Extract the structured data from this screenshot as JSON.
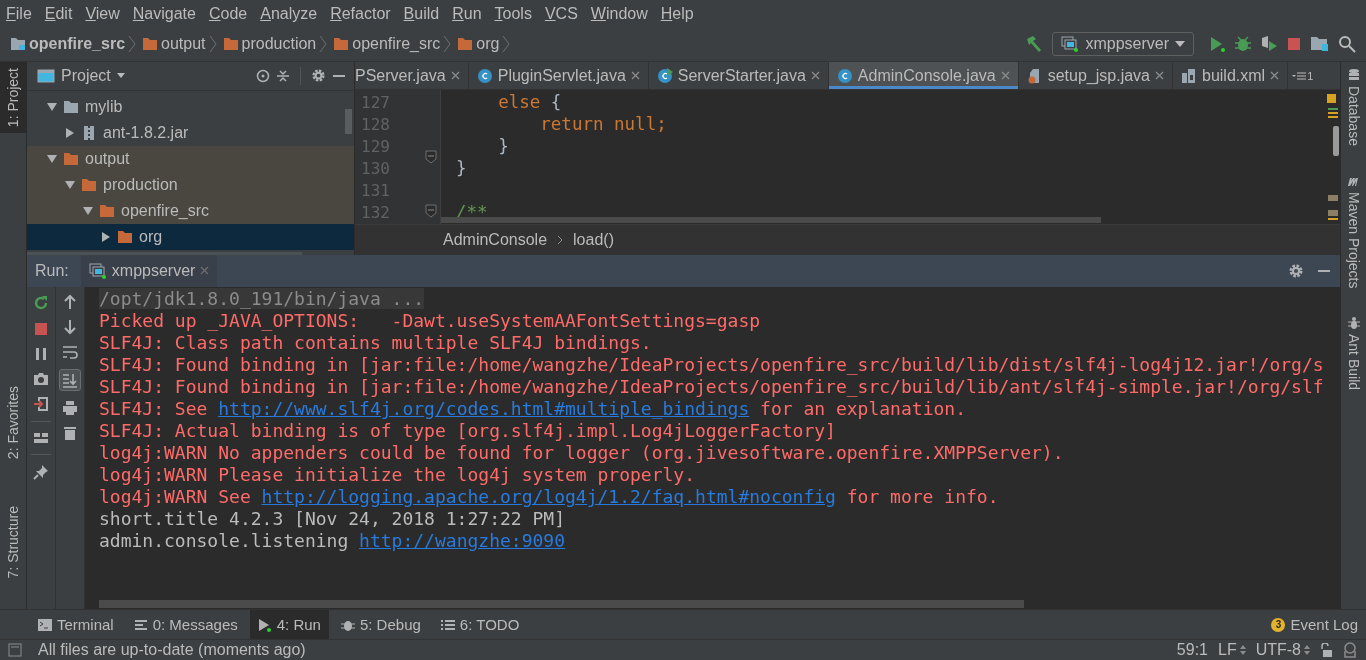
{
  "menu": [
    "File",
    "Edit",
    "View",
    "Navigate",
    "Code",
    "Analyze",
    "Refactor",
    "Build",
    "Run",
    "Tools",
    "VCS",
    "Window",
    "Help"
  ],
  "nav_bar": {
    "breadcrumbs": [
      {
        "label": "openfire_src",
        "kind": "module"
      },
      {
        "label": "output",
        "kind": "folder"
      },
      {
        "label": "production",
        "kind": "folder"
      },
      {
        "label": "openfire_src",
        "kind": "folder"
      },
      {
        "label": "org",
        "kind": "folder"
      }
    ],
    "run_config": "xmppserver"
  },
  "left_strip": [
    {
      "label": "1: Project",
      "selected": true
    },
    {
      "label": "2: Favorites",
      "selected": false
    },
    {
      "label": "7: Structure",
      "selected": false
    }
  ],
  "right_strip": [
    "Database",
    "Maven Projects",
    "Ant Build"
  ],
  "project": {
    "title": "Project",
    "tree": [
      {
        "label": "mylib",
        "kind": "folder",
        "excluded": false,
        "expanded": true,
        "selected": false,
        "children": [
          {
            "label": "ant-1.8.2.jar",
            "kind": "jar",
            "excluded": false,
            "expanded": false,
            "selected": false
          }
        ]
      },
      {
        "label": "output",
        "kind": "folder",
        "excluded": true,
        "expanded": true,
        "selected": false,
        "children": [
          {
            "label": "production",
            "kind": "folder",
            "excluded": true,
            "expanded": true,
            "selected": false,
            "children": [
              {
                "label": "openfire_src",
                "kind": "folder",
                "excluded": true,
                "expanded": true,
                "selected": false,
                "children": [
                  {
                    "label": "org",
                    "kind": "folder",
                    "excluded": true,
                    "expanded": false,
                    "selected": true
                  }
                ]
              }
            ]
          }
        ]
      }
    ]
  },
  "editor": {
    "tabs": [
      {
        "label": "PServer.java",
        "kind": "cut",
        "selected": false
      },
      {
        "label": "PluginServlet.java",
        "kind": "class",
        "selected": false
      },
      {
        "label": "ServerStarter.java",
        "kind": "class_run",
        "selected": false
      },
      {
        "label": "AdminConsole.java",
        "kind": "class",
        "selected": true
      },
      {
        "label": "setup_jsp.java",
        "kind": "jsp",
        "selected": false
      },
      {
        "label": "build.xml",
        "kind": "xml",
        "selected": false
      }
    ],
    "hidden_tabs": "1",
    "lines": [
      {
        "number": "127",
        "segments": [
          {
            "text": "    else",
            "kind": "keyword"
          },
          {
            "text": " {",
            "kind": "plain"
          }
        ]
      },
      {
        "number": "128",
        "segments": [
          {
            "text": "        return null;",
            "kind": "keyword"
          }
        ]
      },
      {
        "number": "129",
        "segments": [
          {
            "text": "    }",
            "kind": "plain"
          }
        ]
      },
      {
        "number": "130",
        "segments": [
          {
            "text": "}",
            "kind": "plain"
          }
        ]
      },
      {
        "number": "131"
      },
      {
        "number": "132",
        "segments": [
          {
            "text": "/**",
            "kind": "comment"
          }
        ]
      }
    ],
    "breadcrumbs": [
      "AdminConsole",
      "load()"
    ]
  },
  "run": {
    "label": "Run:",
    "tab": "xmppserver",
    "autoscroll": {
      "on": true
    },
    "console": [
      {
        "kind": "command",
        "segments": [
          {
            "text": "/opt/jdk1.8.0_191/bin/java ...",
            "kind": "text"
          }
        ]
      },
      {
        "kind": "error",
        "segments": [
          {
            "text": "Picked up _JAVA_OPTIONS:   -Dawt.useSystemAAFontSettings=gasp",
            "kind": "text"
          }
        ]
      },
      {
        "kind": "error",
        "segments": [
          {
            "text": "SLF4J: Class path contains multiple SLF4J bindings.",
            "kind": "text"
          }
        ]
      },
      {
        "kind": "error",
        "segments": [
          {
            "text": "SLF4J: Found binding in [jar:file:/home/wangzhe/IdeaProjects/openfire_src/build/lib/dist/slf4j-log4j12.jar!/org/s",
            "kind": "text"
          }
        ]
      },
      {
        "kind": "error",
        "segments": [
          {
            "text": "SLF4J: Found binding in [jar:file:/home/wangzhe/IdeaProjects/openfire_src/build/lib/ant/slf4j-simple.jar!/org/slf",
            "kind": "text"
          }
        ]
      },
      {
        "kind": "error",
        "segments": [
          {
            "text": "SLF4J: See ",
            "kind": "text"
          },
          {
            "text": "http://www.slf4j.org/codes.html#multiple_bindings",
            "kind": "link"
          },
          {
            "text": " for an explanation.",
            "kind": "text"
          }
        ]
      },
      {
        "kind": "error",
        "segments": [
          {
            "text": "SLF4J: Actual binding is of type [org.slf4j.impl.Log4jLoggerFactory]",
            "kind": "text"
          }
        ]
      },
      {
        "kind": "error",
        "segments": [
          {
            "text": "log4j:WARN No appenders could be found for logger (org.jivesoftware.openfire.XMPPServer).",
            "kind": "text"
          }
        ]
      },
      {
        "kind": "error",
        "segments": [
          {
            "text": "log4j:WARN Please initialize the log4j system properly.",
            "kind": "text"
          }
        ]
      },
      {
        "kind": "error",
        "segments": [
          {
            "text": "log4j:WARN See ",
            "kind": "text"
          },
          {
            "text": "http://logging.apache.org/log4j/1.2/faq.html#noconfig",
            "kind": "link"
          },
          {
            "text": " for more info.",
            "kind": "text"
          }
        ]
      },
      {
        "kind": "normal",
        "segments": [
          {
            "text": "short.title 4.2.3 [Nov 24, 2018 1:27:22 PM]",
            "kind": "text"
          }
        ]
      },
      {
        "kind": "normal",
        "segments": [
          {
            "text": "admin.console.listening ",
            "kind": "text"
          },
          {
            "text": "http://wangzhe:9090",
            "kind": "link"
          }
        ]
      }
    ]
  },
  "tool_tabs": [
    {
      "label": "Terminal",
      "kind": "terminal",
      "selected": false
    },
    {
      "label": "0: Messages",
      "kind": "messages",
      "selected": false
    },
    {
      "label": "4: Run",
      "kind": "run",
      "selected": true
    },
    {
      "label": "5: Debug",
      "kind": "debug",
      "selected": false
    },
    {
      "label": "6: TODO",
      "kind": "todo",
      "selected": false
    }
  ],
  "event_log": {
    "label": "Event Log",
    "badge": "3"
  },
  "status_bar": {
    "message": "All files are up-to-date (moments ago)",
    "position": "59:1",
    "line_separator": "LF",
    "encoding": "UTF-8"
  }
}
